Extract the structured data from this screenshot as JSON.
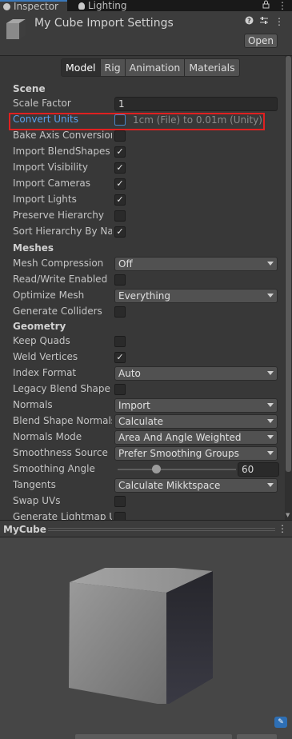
{
  "tabs": {
    "inspector": "Inspector",
    "lighting": "Lighting"
  },
  "header": {
    "title": "My Cube Import Settings",
    "open_label": "Open"
  },
  "model_tabs": [
    "Model",
    "Rig",
    "Animation",
    "Materials"
  ],
  "sections": {
    "scene": "Scene",
    "meshes": "Meshes",
    "geometry": "Geometry"
  },
  "scene": {
    "scale_factor_label": "Scale Factor",
    "scale_factor_value": "1",
    "convert_units_label": "Convert Units",
    "convert_units_text": "1cm (File) to 0.01m (Unity)",
    "bake_axis_label": "Bake Axis Conversion",
    "import_blendshapes_label": "Import BlendShapes",
    "import_visibility_label": "Import Visibility",
    "import_cameras_label": "Import Cameras",
    "import_lights_label": "Import Lights",
    "preserve_hierarchy_label": "Preserve Hierarchy",
    "sort_hierarchy_label": "Sort Hierarchy By Name"
  },
  "meshes": {
    "mesh_compression_label": "Mesh Compression",
    "mesh_compression_value": "Off",
    "read_write_label": "Read/Write Enabled",
    "optimize_mesh_label": "Optimize Mesh",
    "optimize_mesh_value": "Everything",
    "generate_colliders_label": "Generate Colliders"
  },
  "geometry": {
    "keep_quads_label": "Keep Quads",
    "weld_vertices_label": "Weld Vertices",
    "index_format_label": "Index Format",
    "index_format_value": "Auto",
    "legacy_blend_label": "Legacy Blend Shape Normals",
    "normals_label": "Normals",
    "normals_value": "Import",
    "blend_shape_normals_label": "Blend Shape Normals",
    "blend_shape_normals_value": "Calculate",
    "normals_mode_label": "Normals Mode",
    "normals_mode_value": "Area And Angle Weighted",
    "smoothness_source_label": "Smoothness Source",
    "smoothness_source_value": "Prefer Smoothing Groups",
    "smoothing_angle_label": "Smoothing Angle",
    "smoothing_angle_value": "60",
    "tangents_label": "Tangents",
    "tangents_value": "Calculate Mikktspace",
    "swap_uvs_label": "Swap UVs",
    "generate_lightmap_label": "Generate Lightmap UVs"
  },
  "checkboxes": {
    "convert_units": false,
    "bake_axis": false,
    "import_blendshapes": true,
    "import_visibility": true,
    "import_cameras": true,
    "import_lights": true,
    "preserve_hierarchy": false,
    "sort_hierarchy": true,
    "read_write": false,
    "generate_colliders": false,
    "keep_quads": false,
    "weld_vertices": true,
    "legacy_blend": false,
    "swap_uvs": false,
    "generate_lightmap": false
  },
  "preview": {
    "title": "MyCube"
  },
  "colors": {
    "accent": "#3a79bb",
    "highlight_box": "#e02020",
    "focus_label": "#5aa0ea"
  },
  "icons": {
    "inspector_tab": "info-icon",
    "lighting_tab": "bulb-icon",
    "lock": "lock-icon",
    "menu": "kebab-icon",
    "help": "help-icon",
    "presets": "sliders-icon",
    "label": "tag-icon"
  }
}
